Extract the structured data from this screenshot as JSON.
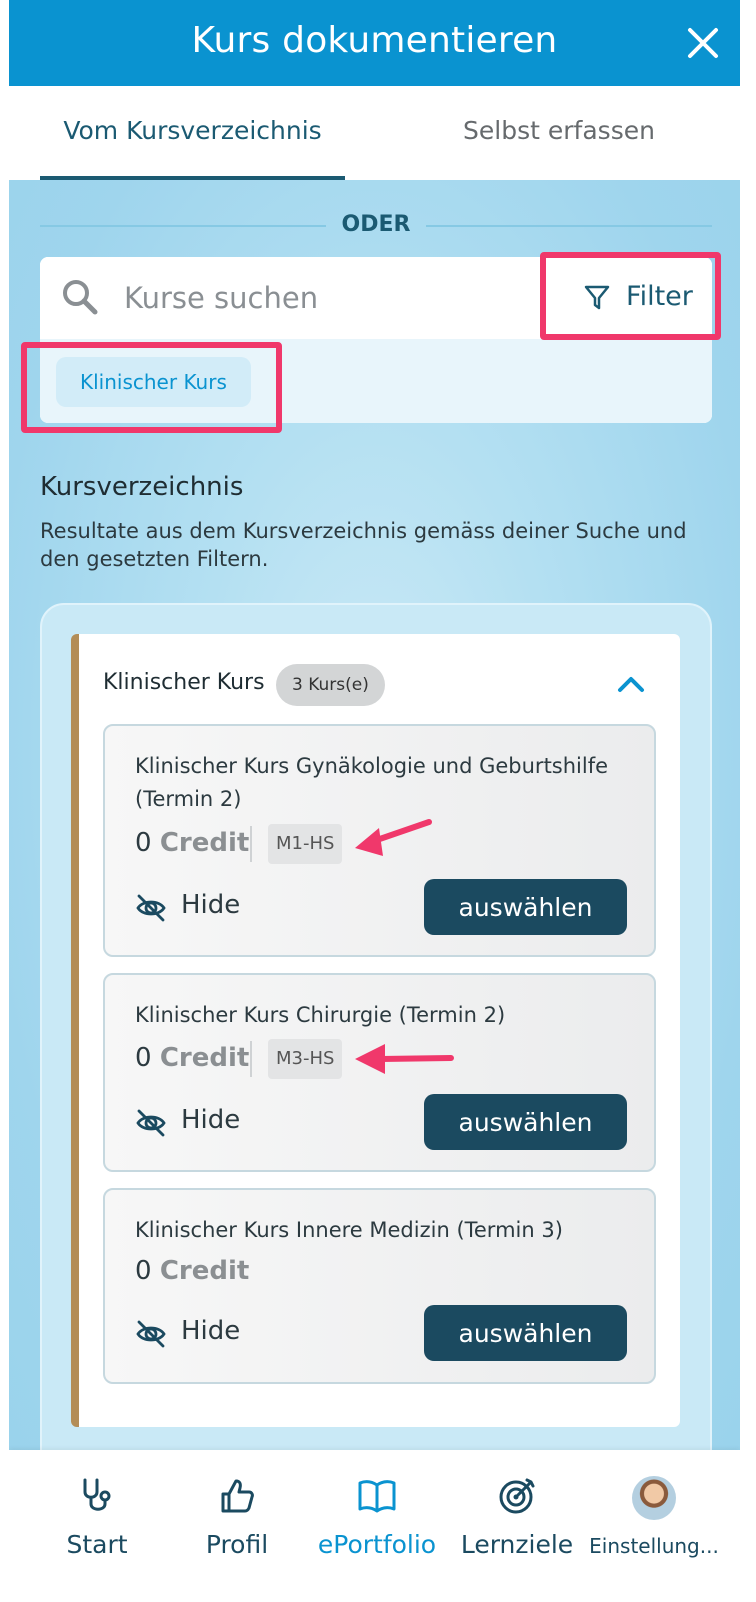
{
  "header": {
    "title": "Kurs dokumentieren"
  },
  "tabs": [
    {
      "label": "Vom Kursverzeichnis",
      "active": true
    },
    {
      "label": "Selbst erfassen",
      "active": false
    }
  ],
  "divider": {
    "label": "ODER"
  },
  "search": {
    "placeholder": "Kurse suchen",
    "value": ""
  },
  "filter": {
    "label": "Filter"
  },
  "active_filters": [
    {
      "label": "Klinischer Kurs"
    }
  ],
  "section": {
    "title": "Kursverzeichnis",
    "description": "Resultate aus dem Kursverzeichnis gemäss deiner Suche und den gesetzten Filtern."
  },
  "group": {
    "title": "Klinischer Kurs",
    "count_label": "3 Kurs(e)",
    "expanded": true
  },
  "courses": [
    {
      "title": "Klinischer Kurs Gynäkologie und Geburtshilfe (Termin 2)",
      "credit_value": "0",
      "credit_label": "Credit",
      "code": "M1-HS",
      "hide_label": "Hide",
      "select_label": "auswählen"
    },
    {
      "title": "Klinischer Kurs Chirurgie (Termin 2)",
      "credit_value": "0",
      "credit_label": "Credit",
      "code": "M3-HS",
      "hide_label": "Hide",
      "select_label": "auswählen"
    },
    {
      "title": "Klinischer Kurs Innere Medizin (Termin 3)",
      "credit_value": "0",
      "credit_label": "Credit",
      "code": null,
      "hide_label": "Hide",
      "select_label": "auswählen"
    }
  ],
  "nav": [
    {
      "label": "Start",
      "icon": "stethoscope-icon",
      "active": false
    },
    {
      "label": "Profil",
      "icon": "thumbs-up-icon",
      "active": false
    },
    {
      "label": "ePortfolio",
      "icon": "open-book-icon",
      "active": true
    },
    {
      "label": "Lernziele",
      "icon": "target-icon",
      "active": false
    },
    {
      "label": "Einstellung...",
      "icon": "avatar",
      "active": false
    }
  ],
  "colors": {
    "header": "#0a93d0",
    "primary_dark": "#1b4a60",
    "highlight": "#f0386b",
    "group_accent": "#b38d57"
  }
}
